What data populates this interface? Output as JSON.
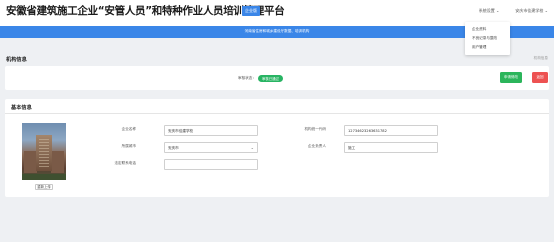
{
  "header": {
    "title": "安徽省建筑施工企业“安管人员”和特种作业人员培训管理平台",
    "version_badge": "企业版",
    "user_menu": "系统设置",
    "company_menu": "安庆市佳建学校"
  },
  "notice": "河南省住房和城乡建设厅数据、培训机构",
  "dropdown": {
    "items": [
      "企业资料",
      "不良记录与整改",
      "用户管理"
    ]
  },
  "section1": {
    "title": "机构信息",
    "right_text": "机构信息",
    "status_label": "审核状态：",
    "status_value": "审核已通过",
    "apply_button": "申请修改",
    "back_button": "返回"
  },
  "section2": {
    "title": "基本信息",
    "upload_button": "重新上传",
    "fields": {
      "company_name_label": "企业名称",
      "company_name_value": "安庆市佳建学校",
      "credit_code_label": "机构统一代码",
      "credit_code_value": "12734623263631782",
      "city_label": "所属城市",
      "city_value": "安庆市",
      "legal_person_label": "企业负责人",
      "legal_person_value": "施工",
      "contact_phone_label": "法定联系电话",
      "contact_phone_value": ""
    }
  }
}
